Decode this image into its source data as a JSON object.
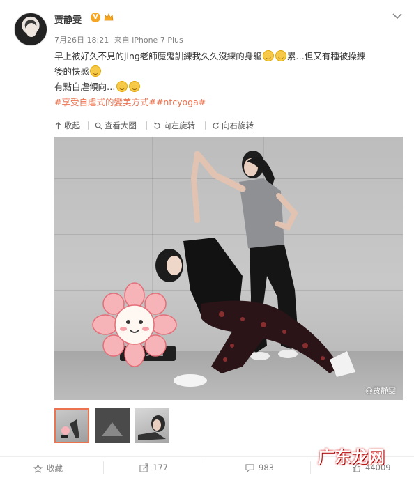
{
  "post": {
    "username": "贾静雯",
    "verified_badge": "V",
    "time": "7月26日 18:21",
    "source": "来自 iPhone 7 Plus",
    "lines": [
      "早上被好久不見的jing老師魔鬼訓練我久久沒練的身軀",
      "累…但又有種被操練",
      "後的快感",
      "有點自虐傾向…"
    ],
    "hashtags": "#享受自虐式的變美方式##ntcyoga#"
  },
  "toolbar": {
    "collapse": "收起",
    "view_large": "查看大图",
    "rotate_left": "向左旋转",
    "rotate_right": "向右旋转"
  },
  "photo": {
    "watermark": "@贾静雯",
    "mat_text": "NING CLUB"
  },
  "actions": {
    "favorite": "收藏",
    "repost_count": "177",
    "comment_count": "983",
    "like_count": "44009"
  },
  "site_logo": "广东龙网",
  "colors": {
    "accent": "#eb7350",
    "verified": "#f5a623"
  }
}
